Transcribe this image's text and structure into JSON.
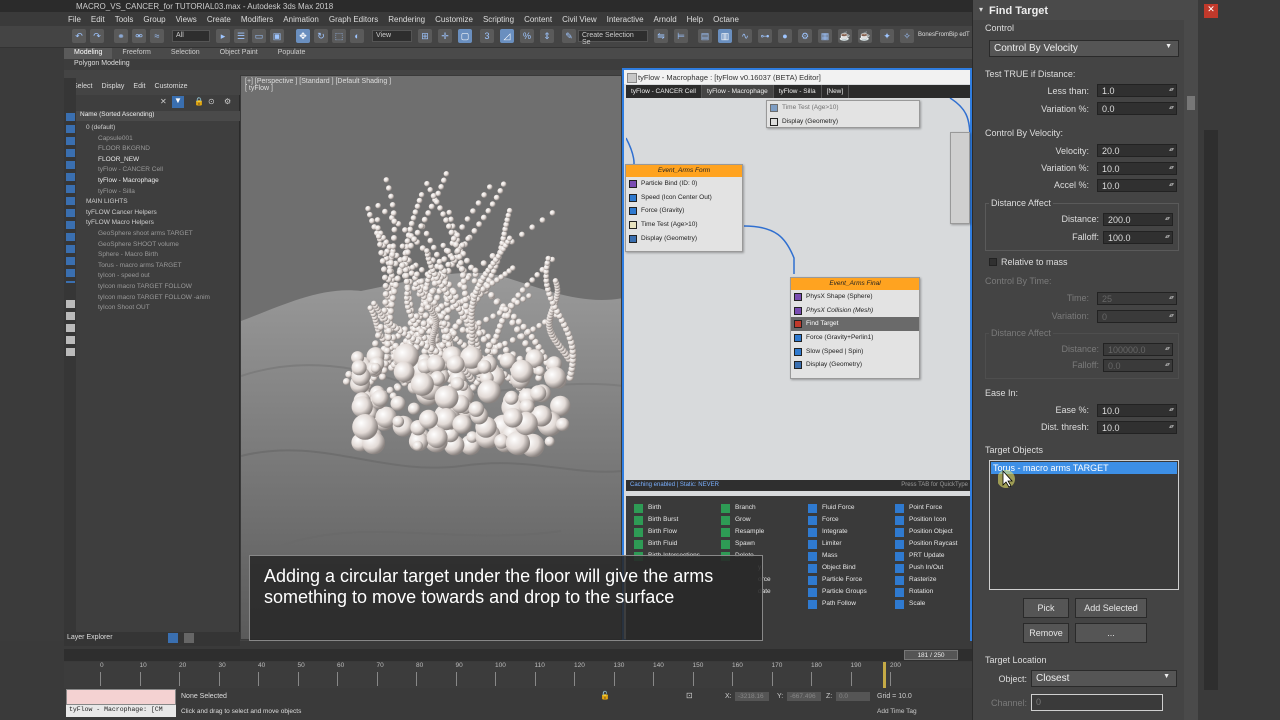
{
  "window": {
    "title": "MACRO_VS_CANCER_for TUTORIAL03.max - Autodesk 3ds Max 2018"
  },
  "menu": [
    "File",
    "Edit",
    "Tools",
    "Group",
    "Views",
    "Create",
    "Modifiers",
    "Animation",
    "Graph Editors",
    "Rendering",
    "Customize",
    "Scripting",
    "Content",
    "Civil View",
    "Interactive",
    "Arnold",
    "Help",
    "Octane"
  ],
  "toolbar": {
    "filter_select": "All",
    "view_select": "View",
    "selection_set": "Create Selection Se",
    "script_label": "BonesFromBip edT"
  },
  "ribbon": {
    "tabs": [
      "Modeling",
      "Freeform",
      "Selection",
      "Object Paint",
      "Populate"
    ],
    "sub": "Polygon Modeling"
  },
  "scene_explorer": {
    "menu": [
      "Select",
      "Display",
      "Edit",
      "Customize"
    ],
    "column_header": "Name (Sorted Ascending)",
    "rows": [
      "0 (default)",
      "Capsule001",
      "FLOOR BKGRND",
      "FLOOR_NEW",
      "tyFlow - CANCER Cell",
      "tyFlow - Macrophage",
      "tyFlow - Silla",
      "MAIN LIGHTS",
      "tyFLOW Cancer Helpers",
      "tyFLOW Macro Helpers",
      "GeoSphere shoot arms TARGET",
      "GeoSphere SHOOT volume",
      "Sphere - Macro Birth",
      "Torus - macro arms TARGET",
      "tyIcon - speed out",
      "tyIcon macro TARGET FOLLOW",
      "tyIcon macro TARGET FOLLOW -anim",
      "tyIcon Shoot OUT"
    ]
  },
  "viewport": {
    "label1": "[+] [Perspective ] [Standard ] [Default Shading ]",
    "label2": "[ tyFlow ]"
  },
  "tyflow": {
    "title": "tyFlow - Macrophage : [tyFlow v0.16037 (BETA) Editor]",
    "tabs": [
      "tyFlow - CANCER Cell",
      "tyFlow - Macrophage",
      "tyFlow - Silla",
      "[New]"
    ],
    "top_node_ops": [
      "Time Test (Age>10)",
      "Display (Geometry)"
    ],
    "node_form": {
      "title": "Event_Arms Form",
      "ops": [
        "Particle Bind (ID: 0)",
        "Speed (Icon Center Out)",
        "Force (Gravity)",
        "Time Test (Age>10)",
        "Display (Geometry)"
      ]
    },
    "node_final": {
      "title": "Event_Arms Final",
      "ops": [
        "PhysX Shape (Sphere)",
        "PhysX Collision (Mesh)",
        "Find Target",
        "Force (Gravity+Perlin1)",
        "Slow (Speed | Spin)",
        "Display (Geometry)"
      ]
    },
    "status_left": "Caching enabled | Static: NEVER",
    "status_right": "Press TAB for QuickType",
    "palette": [
      [
        "Birth",
        "Birth Burst",
        "Birth Flow",
        "Birth Fluid",
        "Birth Intersections"
      ],
      [
        "Branch",
        "Grow",
        "Resample",
        "Spawn",
        "Delete"
      ],
      [
        "Fluid Force",
        "Force",
        "Integrate",
        "Limiter",
        "Mass",
        "Object Bind",
        "Particle Force",
        "Particle Groups",
        "Path Follow"
      ],
      [
        "Point Force",
        "Position Icon",
        "Position Object",
        "Position Raycast",
        "PRT Update",
        "Push In/Out",
        "Rasterize",
        "Rotation",
        "Scale"
      ]
    ],
    "palette_partial": [
      "y",
      "orce",
      "date"
    ]
  },
  "caption": "Adding a circular target under the floor will give the arms something to move towards and drop to the surface",
  "panel": {
    "title": "Find Target",
    "control_label": "Control",
    "control_value": "Control By Velocity",
    "dist_group": "Test TRUE if Distance:",
    "less_than": "Less than:",
    "less_than_val": "1.0",
    "variation": "Variation %:",
    "variation_val": "0.0",
    "vel_group": "Control By Velocity:",
    "velocity": "Velocity:",
    "velocity_val": "20.0",
    "vel_var": "Variation %:",
    "vel_var_val": "10.0",
    "accel": "Accel %:",
    "accel_val": "10.0",
    "dist_affect": "Distance Affect",
    "distance": "Distance:",
    "distance_val": "200.0",
    "falloff": "Falloff:",
    "falloff_val": "100.0",
    "relative": "Relative to mass",
    "time_group": "Control By Time:",
    "time": "Time:",
    "time_val": "25",
    "time_var": "Variation:",
    "time_var_val": "0",
    "dist_affect2": "Distance Affect",
    "distance2": "Distance:",
    "distance2_val": "100000.0",
    "falloff2": "Falloff:",
    "falloff2_val": "0.0",
    "ease_in": "Ease In:",
    "ease": "Ease %:",
    "ease_val": "10.0",
    "thresh": "Dist. thresh:",
    "thresh_val": "10.0",
    "target_objects": "Target Objects",
    "target_item": "Torus - macro arms TARGET",
    "pick": "Pick",
    "add_selected": "Add Selected",
    "remove": "Remove",
    "more": "...",
    "target_location": "Target Location",
    "object": "Object:",
    "object_val": "Closest",
    "channel": "Channel:",
    "channel_val": "0"
  },
  "bottom": {
    "layer_explorer": "Layer Explorer",
    "frame": "181 / 250",
    "ticks": [
      "0",
      "10",
      "20",
      "30",
      "40",
      "50",
      "60",
      "70",
      "80",
      "90",
      "100",
      "110",
      "120",
      "130",
      "140",
      "150",
      "160",
      "170",
      "180",
      "190",
      "200"
    ],
    "listener": "tyFlow - Macrophage: [CM",
    "status1": "None Selected",
    "status2": "Click and drag to select and move objects",
    "x_label": "X:",
    "x_val": "-3218.16",
    "y_label": "Y:",
    "y_val": "-667.496",
    "z_label": "Z:",
    "z_val": "0.0",
    "grid": "Grid = 10.0",
    "add_time_tag": "Add Time Tag"
  }
}
